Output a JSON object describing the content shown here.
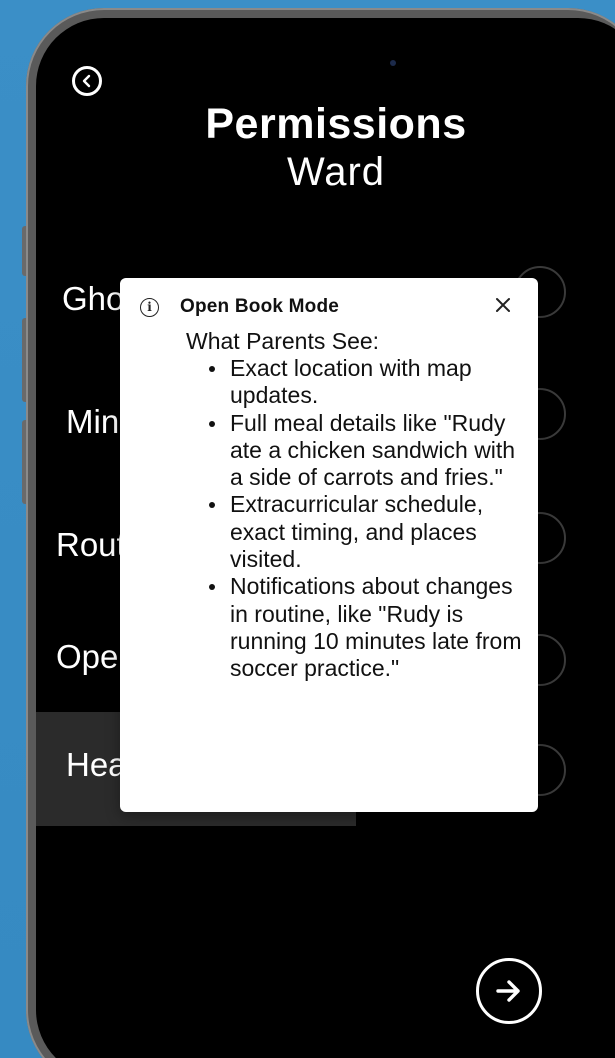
{
  "screen": {
    "title": "Permissions",
    "subtitle": "Ward",
    "options": [
      {
        "label": "Ghost Mode"
      },
      {
        "label": "Mindful Mode"
      },
      {
        "label": "Routine Mode"
      },
      {
        "label": "Open Book Mode"
      },
      {
        "label": "Heads-Up Mode"
      }
    ],
    "back_icon": "chevron-left-circle-icon",
    "next_icon": "arrow-right-circle-icon"
  },
  "modal": {
    "icon": "info-icon",
    "title": "Open Book  Mode",
    "close_icon": "close-icon",
    "heading": "What Parents See:",
    "items": [
      "Exact location with map updates.",
      "Full meal details like \"Rudy ate a chicken sandwich with a side of carrots and fries.\"",
      "Extracurricular schedule, exact timing, and places visited.",
      "Notifications about changes in routine, like \"Rudy is running 10 minutes late from soccer practice.\""
    ]
  },
  "colors": {
    "background": "#3a8cc4",
    "screen": "#000000",
    "highlight_row": "#2b2b2b",
    "modal": "#ffffff"
  }
}
